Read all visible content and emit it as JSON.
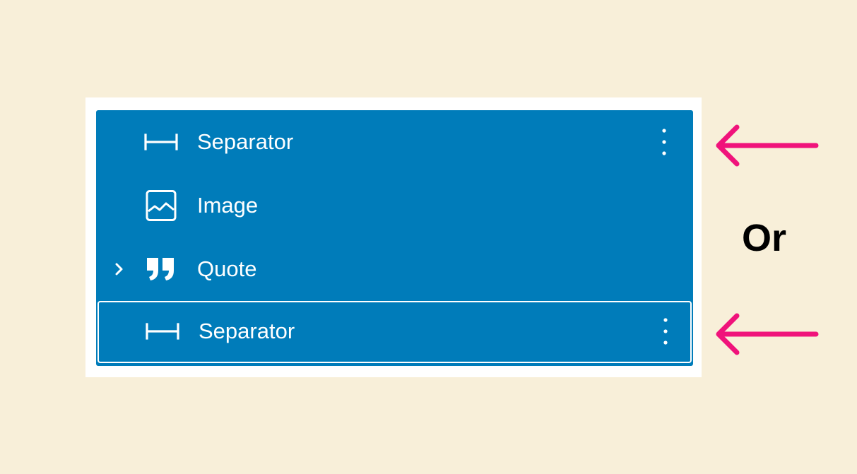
{
  "list_view": {
    "rows": [
      {
        "label": "Separator",
        "icon": "separator-icon",
        "selected": true,
        "has_options": true
      },
      {
        "label": "Image",
        "icon": "image-icon",
        "selected": true,
        "has_options": false
      },
      {
        "label": "Quote",
        "icon": "quote-icon",
        "selected": true,
        "has_expander": true,
        "has_options": false
      },
      {
        "label": "Separator",
        "icon": "separator-icon",
        "selected": true,
        "focused": true,
        "has_options": true
      }
    ]
  },
  "annotation": {
    "or_text": "Or",
    "arrow_color": "#f0137b"
  },
  "colors": {
    "background": "#f8efd9",
    "panel": "#ffffff",
    "selection": "#007cba",
    "text": "#ffffff"
  }
}
